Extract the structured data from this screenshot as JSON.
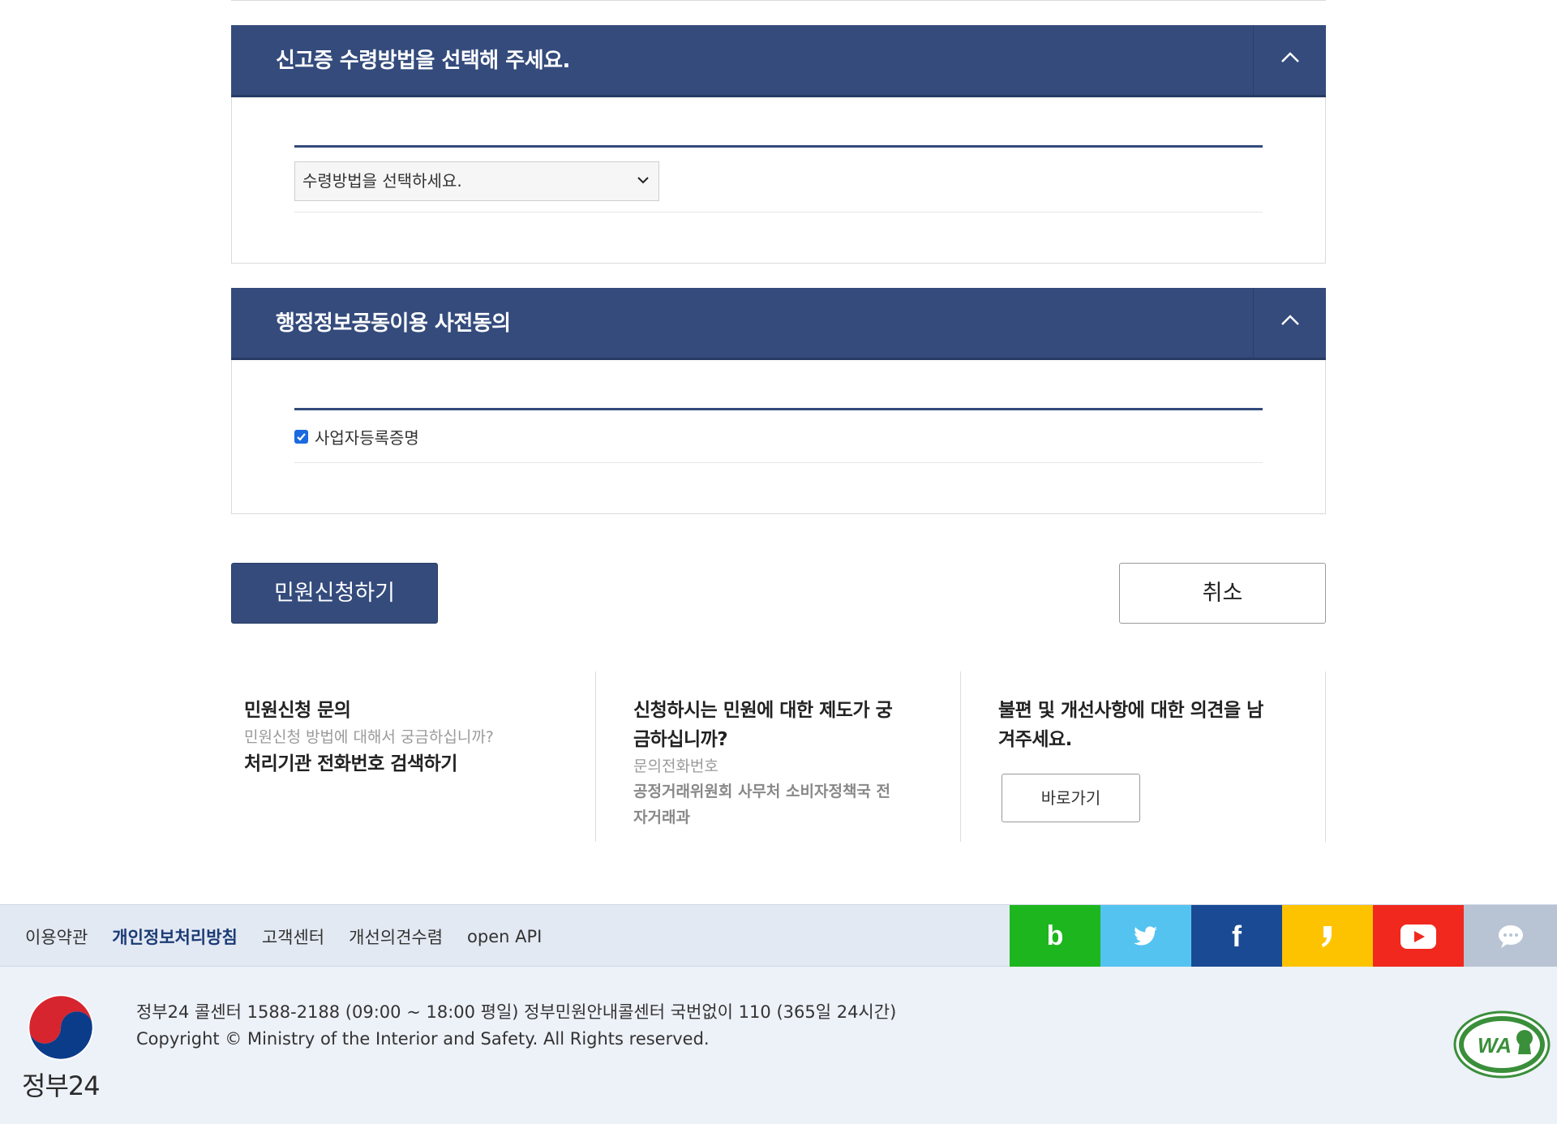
{
  "receipt_panel": {
    "title": "신고증 수령방법을 선택해 주세요.",
    "select_value": "수령방법을 선택하세요."
  },
  "consent_panel": {
    "title": "행정정보공동이용 사전동의",
    "checkbox_label": "사업자등록증명",
    "checked": true
  },
  "actions": {
    "submit_label": "민원신청하기",
    "cancel_label": "취소"
  },
  "info": {
    "col1": {
      "title": "민원신청 문의",
      "sub": "민원신청 방법에 대해서 궁금하십니까?",
      "link": "처리기관 전화번호 검색하기"
    },
    "col2": {
      "title_line1": "신청하시는 민원에 대한 제도가 궁",
      "title_line2": "금하십니까?",
      "sub": "문의전화번호",
      "dept_line1": "공정거래위원회 사무처 소비자정책국 전",
      "dept_line2": "자거래과"
    },
    "col3": {
      "title_line1": "불편 및 개선사항에 대한 의견을 남",
      "title_line2": "겨주세요.",
      "button": "바로가기"
    }
  },
  "footer": {
    "links": [
      "이용약관",
      "개인정보처리방침",
      "고객센터",
      "개선의견수렴",
      "open API"
    ],
    "social": [
      {
        "name": "blog",
        "color": "#1db61e",
        "glyph": "b"
      },
      {
        "name": "twitter",
        "color": "#55c3f0",
        "glyph": ""
      },
      {
        "name": "facebook",
        "color": "#1a4a94",
        "glyph": "f"
      },
      {
        "name": "kakao-story",
        "color": "#fdc300",
        "glyph": ""
      },
      {
        "name": "youtube",
        "color": "#f0281e",
        "glyph": ""
      },
      {
        "name": "chatbot",
        "color": "#b8c4d4",
        "glyph": ""
      }
    ],
    "brand": "정부24",
    "callcenter": "정부24 콜센터 1588-2188 (09:00 ~ 18:00 평일) 정부민원안내콜센터 국번없이 110 (365일 24시간)",
    "copyright": "Copyright © Ministry of the Interior and Safety. All Rights reserved.",
    "wa_mark": "WA"
  }
}
